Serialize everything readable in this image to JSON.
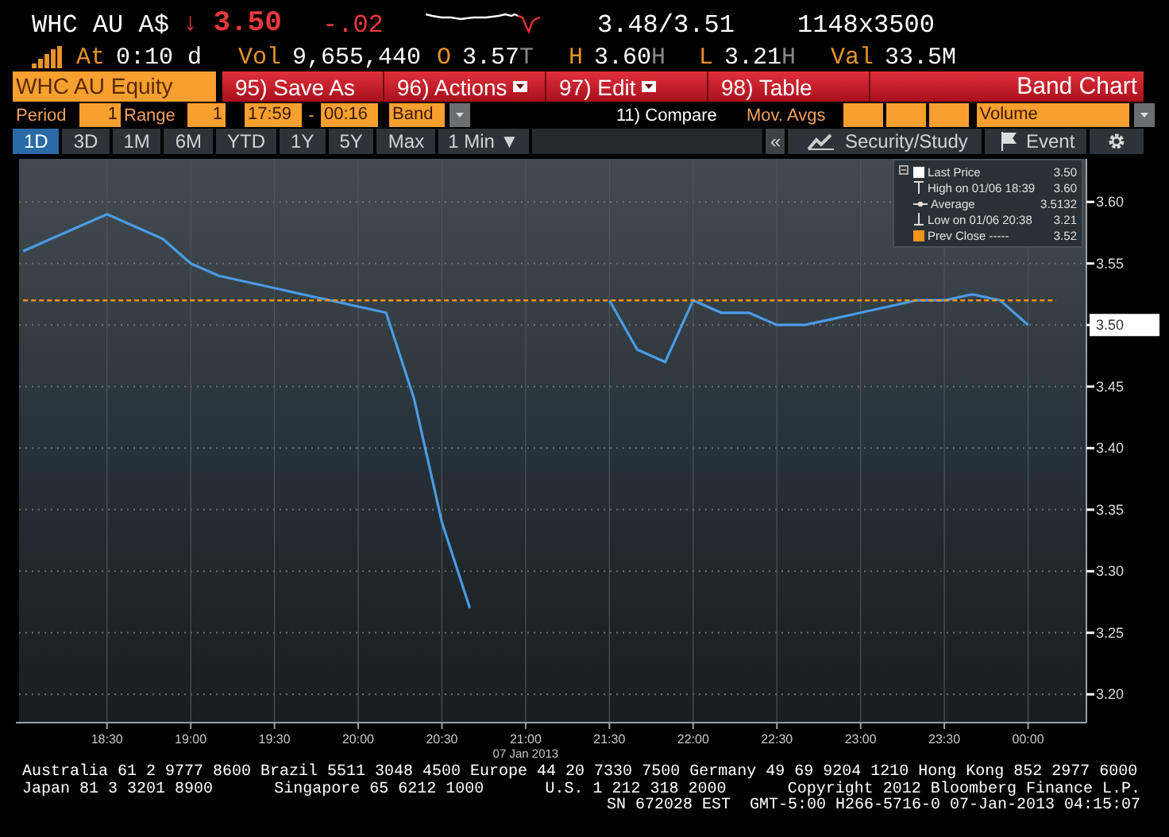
{
  "quote": {
    "ticker": "WHC AU A$",
    "arrow": "↓",
    "price": "3.50",
    "change": "-.02",
    "bid_ask": "3.48/3.51",
    "size": "1148x3500"
  },
  "stats": [
    {
      "label": "At",
      "value": "0:10 d"
    },
    {
      "label": "Vol",
      "value": "9,655,440"
    },
    {
      "label": "O",
      "value": "3.57",
      "suffix": "T"
    },
    {
      "label": "H",
      "value": "3.60",
      "suffix": "H"
    },
    {
      "label": "L",
      "value": "3.21",
      "suffix": "H"
    },
    {
      "label": "Val",
      "value": "33.5M"
    }
  ],
  "toolbar": {
    "security": "WHC AU Equity",
    "title": "Band Chart",
    "buttons": [
      {
        "label": "95) Save As",
        "menu": false
      },
      {
        "label": "96) Actions",
        "menu": true
      },
      {
        "label": "97) Edit",
        "menu": true
      },
      {
        "label": "98) Table",
        "menu": false
      }
    ]
  },
  "controls": {
    "period_label": "Period",
    "period": "1",
    "range_label": "Range",
    "range": "1",
    "start": "17:59",
    "separator": "-",
    "end": "00:16",
    "band": "Band",
    "compare": "11) Compare",
    "mov_avgs_label": "Mov. Avgs",
    "volume": "Volume"
  },
  "tabs": [
    {
      "label": "1D",
      "selected": true
    },
    {
      "label": "3D",
      "selected": false
    },
    {
      "label": "1M",
      "selected": false
    },
    {
      "label": "6M",
      "selected": false
    },
    {
      "label": "YTD",
      "selected": false
    },
    {
      "label": "1Y",
      "selected": false
    },
    {
      "label": "5Y",
      "selected": false
    },
    {
      "label": "Max",
      "selected": false
    }
  ],
  "interval": {
    "label": "1 Min",
    "arrow": "▼"
  },
  "tools": {
    "collapse": "«",
    "security_study": "Security/Study",
    "event": "Event"
  },
  "legend": [
    {
      "kind": "series",
      "color": "#ffffff",
      "value": "3.50"
    },
    {
      "kind": "high",
      "label": "High on 01/06 18:39",
      "value": "3.60"
    },
    {
      "kind": "average",
      "label": "Average",
      "value": "3.5132"
    },
    {
      "kind": "low",
      "label": "Low on 01/06 20:38",
      "value": "3.21"
    },
    {
      "kind": "series",
      "color": "#f7941d",
      "dash": "-----",
      "value": "3.52"
    }
  ],
  "chart_data": {
    "type": "line",
    "xlabel": "07 Jan 2013",
    "categories": [
      null,
      null,
      null,
      "18:30",
      null,
      null,
      "19:00",
      null,
      null,
      "19:30",
      null,
      null,
      "20:00",
      null,
      null,
      "20:30",
      null,
      null,
      "21:00",
      null,
      null,
      "21:30",
      null,
      null,
      "22:00",
      null,
      null,
      "22:30",
      null,
      null,
      "23:00",
      null,
      null,
      "23:30",
      null,
      null,
      "00:00",
      null
    ],
    "series": [
      {
        "name": "Last Price",
        "color": "#4a9be8",
        "values": [
          3.56,
          3.57,
          3.58,
          3.59,
          3.58,
          3.57,
          3.55,
          3.54,
          3.535,
          3.53,
          3.525,
          3.52,
          3.515,
          3.51,
          3.44,
          3.34,
          3.27,
          null,
          null,
          null,
          null,
          3.52,
          3.48,
          3.47,
          3.52,
          3.51,
          3.51,
          3.5,
          3.5,
          3.505,
          3.51,
          3.515,
          3.52,
          3.52,
          3.525,
          3.52,
          3.5,
          null
        ]
      },
      {
        "name": "Prev Close",
        "color": "#f7941d",
        "line_style": "dashed",
        "values": [
          3.52,
          3.52,
          3.52,
          3.52,
          3.52,
          3.52,
          3.52,
          3.52,
          3.52,
          3.52,
          3.52,
          3.52,
          3.52,
          3.52,
          3.52,
          3.52,
          3.52,
          3.52,
          3.52,
          3.52,
          3.52,
          3.52,
          3.52,
          3.52,
          3.52,
          3.52,
          3.52,
          3.52,
          3.52,
          3.52,
          3.52,
          3.52,
          3.52,
          3.52,
          3.52,
          3.52,
          3.52,
          3.52
        ]
      }
    ],
    "ylim": [
      3.177,
      3.635
    ],
    "yticks": [
      {
        "value": 3.6,
        "label": "3.60"
      },
      {
        "value": 3.55,
        "label": "3.55"
      },
      {
        "value": 3.5,
        "label": "3.50"
      },
      {
        "value": 3.45,
        "label": "3.45"
      },
      {
        "value": 3.4,
        "label": "3.40"
      },
      {
        "value": 3.35,
        "label": "3.35"
      },
      {
        "value": 3.3,
        "label": "3.30"
      },
      {
        "value": 3.25,
        "label": "3.25"
      },
      {
        "value": 3.2,
        "label": "3.20"
      }
    ],
    "grid": true
  },
  "footer": {
    "line_1": "Australia 61 2 9777 8600 Brazil 5511 3048 4500 Europe 44 20 7330 7500 Germany 49 69 9204 1210 Hong Kong 852 2977 6000",
    "line_2": [
      "Japan 81 3 3201 8900",
      "Singapore 65 6212 1000",
      "U.S. 1 212 318 2000",
      "Copyright 2012 Bloomberg Finance L.P."
    ],
    "line_3": "SN 672028 EST  GMT-5:00 H266-5716-0 07-Jan-2013 04:15:07"
  }
}
